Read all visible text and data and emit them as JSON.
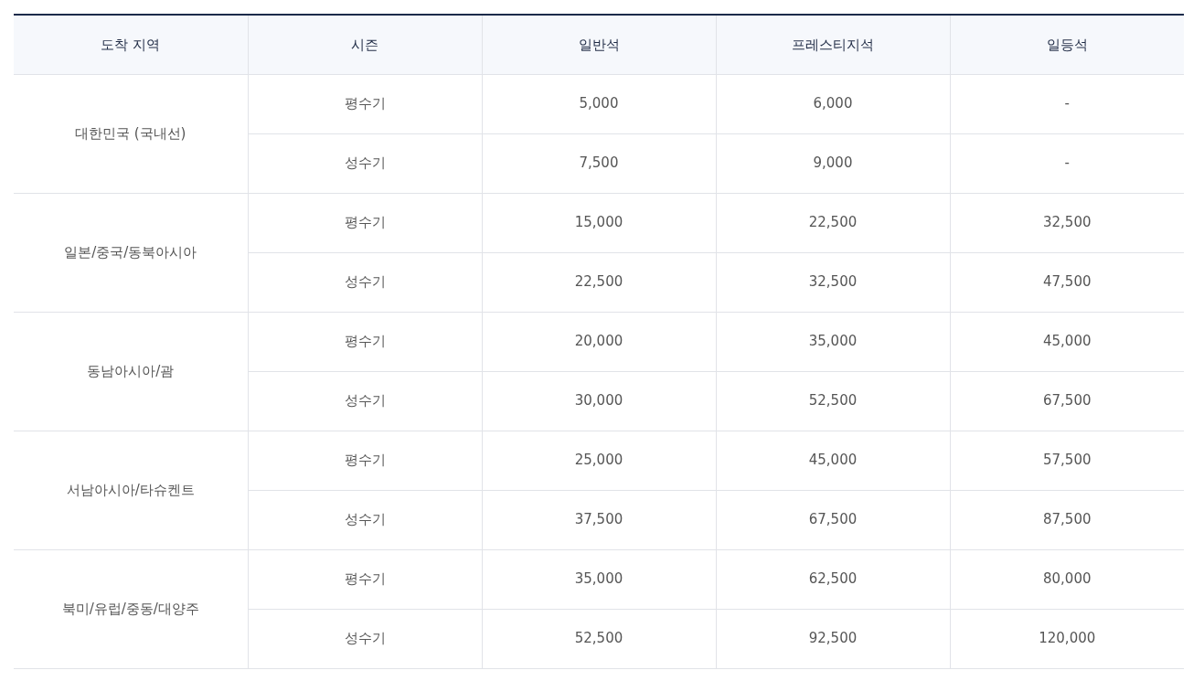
{
  "table": {
    "columns": [
      "도착 지역",
      "시즌",
      "일반석",
      "프레스티지석",
      "일등석"
    ],
    "groups": [
      {
        "region": "대한민국 (국내선)",
        "rows": [
          [
            "평수기",
            "5,000",
            "6,000",
            "-"
          ],
          [
            "성수기",
            "7,500",
            "9,000",
            "-"
          ]
        ]
      },
      {
        "region": "일본/중국/동북아시아",
        "rows": [
          [
            "평수기",
            "15,000",
            "22,500",
            "32,500"
          ],
          [
            "성수기",
            "22,500",
            "32,500",
            "47,500"
          ]
        ]
      },
      {
        "region": "동남아시아/괌",
        "rows": [
          [
            "평수기",
            "20,000",
            "35,000",
            "45,000"
          ],
          [
            "성수기",
            "30,000",
            "52,500",
            "67,500"
          ]
        ]
      },
      {
        "region": "서남아시아/타슈켄트",
        "rows": [
          [
            "평수기",
            "25,000",
            "45,000",
            "57,500"
          ],
          [
            "성수기",
            "37,500",
            "67,500",
            "87,500"
          ]
        ]
      },
      {
        "region": "북미/유럽/중동/대양주",
        "rows": [
          [
            "평수기",
            "35,000",
            "62,500",
            "80,000"
          ],
          [
            "성수기",
            "52,500",
            "92,500",
            "120,000"
          ]
        ]
      }
    ]
  }
}
